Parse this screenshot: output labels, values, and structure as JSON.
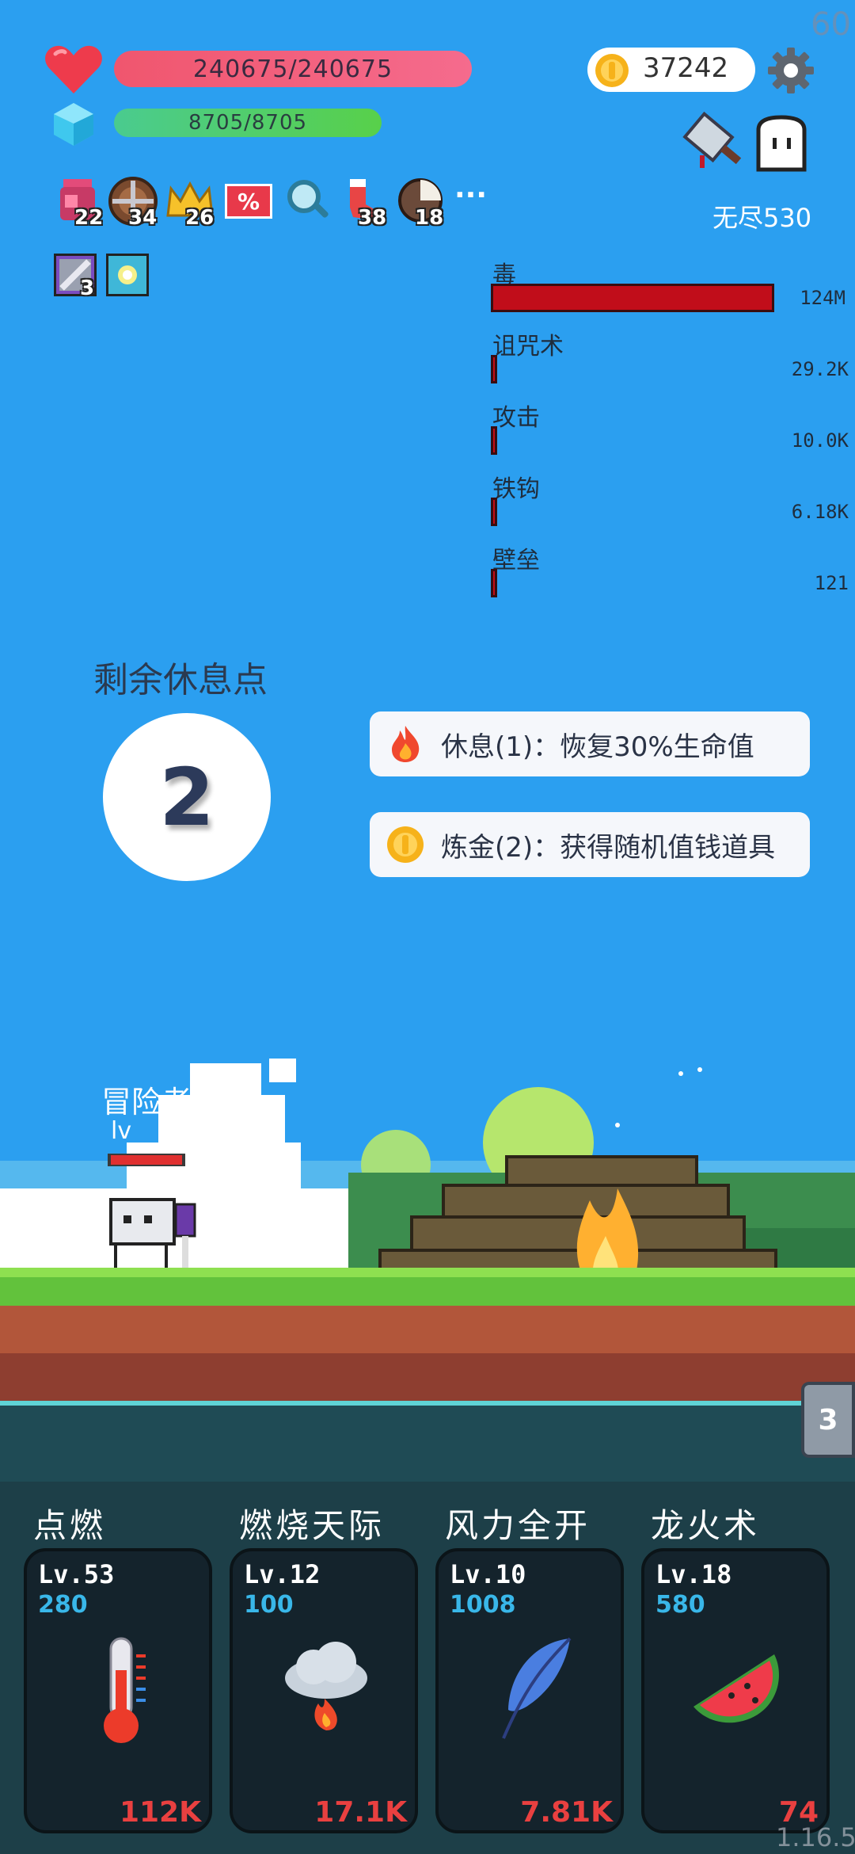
{
  "fps": "60",
  "version": "1.16.5",
  "hp": {
    "text": "240675/240675",
    "fraction": 1.0
  },
  "mp": {
    "text": "8705/8705",
    "fraction": 1.0
  },
  "coins": "37242",
  "mode_label": "无尽530",
  "items": [
    {
      "icon": "jam-jar-icon",
      "count": "22"
    },
    {
      "icon": "shield-icon",
      "count": "34"
    },
    {
      "icon": "crown-icon",
      "count": "26"
    },
    {
      "icon": "percent-icon",
      "label": "%"
    },
    {
      "icon": "magnifier-icon"
    },
    {
      "icon": "sock-icon",
      "count": "38"
    },
    {
      "icon": "coconut-icon",
      "count": "18"
    },
    {
      "icon": "more-icon",
      "label": "···"
    }
  ],
  "buffs": [
    {
      "icon": "sword-buff-icon",
      "count": "3"
    },
    {
      "icon": "light-buff-icon"
    }
  ],
  "damage_stats": [
    {
      "label": "毒",
      "value": "124M",
      "fraction": 1.0
    },
    {
      "label": "诅咒术",
      "value": "29.2K",
      "fraction": 0.02
    },
    {
      "label": "攻击",
      "value": "10.0K",
      "fraction": 0.01
    },
    {
      "label": "铁钩",
      "value": "6.18K",
      "fraction": 0.01
    },
    {
      "label": "壁垒",
      "value": "121",
      "fraction": 0.01
    }
  ],
  "rest": {
    "title": "剩余休息点",
    "points": "2",
    "options": [
      {
        "icon": "fire-icon",
        "text": "休息(1)：恢复30%生命值"
      },
      {
        "icon": "coin-icon",
        "text": "炼金(2)：获得随机值钱道具"
      }
    ]
  },
  "player": {
    "name": "冒险者",
    "level": "lv"
  },
  "side_tab": "3",
  "skills": [
    {
      "name": "点燃",
      "level": "Lv.53",
      "cost": "280",
      "value": "112K",
      "icon": "thermometer-icon"
    },
    {
      "name": "燃烧天际",
      "level": "Lv.12",
      "cost": "100",
      "value": "17.1K",
      "icon": "fire-cloud-icon"
    },
    {
      "name": "风力全开",
      "level": "Lv.10",
      "cost": "1008",
      "value": "7.81K",
      "icon": "feather-icon"
    },
    {
      "name": "龙火术",
      "level": "Lv.18",
      "cost": "580",
      "value": "74",
      "icon": "watermelon-icon"
    }
  ]
}
